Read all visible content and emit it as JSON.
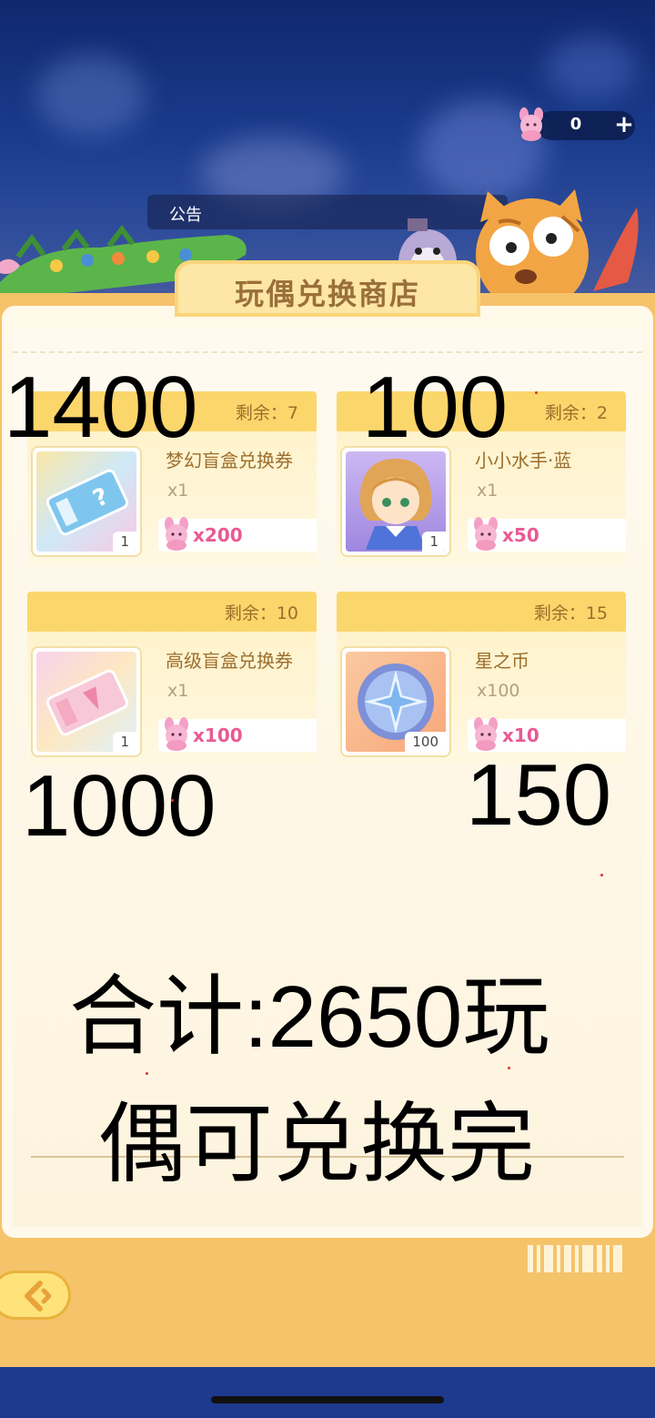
{
  "header": {
    "currency_count": "0",
    "currency_plus": "+",
    "notice_label": "公告"
  },
  "shop": {
    "title": "玩偶兑换商店",
    "remain_prefix": "剩余：",
    "items": [
      {
        "remain": "剩余：7",
        "name": "梦幻盲盒兑换券",
        "qty": "x1",
        "thumb_qty": "1",
        "price": "x200",
        "icon": "rainbow-ticket-icon"
      },
      {
        "remain": "剩余：2",
        "name": "小小水手·蓝",
        "qty": "x1",
        "thumb_qty": "1",
        "price": "x50",
        "icon": "sailor-doll-icon"
      },
      {
        "remain": "剩余：10",
        "name": "高级盲盒兑换券",
        "qty": "x1",
        "thumb_qty": "1",
        "price": "x100",
        "icon": "pink-ticket-icon"
      },
      {
        "remain": "剩余：15",
        "name": "星之币",
        "qty": "x100",
        "thumb_qty": "100",
        "price": "x10",
        "icon": "star-coin-icon"
      }
    ],
    "price_icon": "pink-bunny-doll-icon"
  },
  "annotations": {
    "card1_total": "1400",
    "card2_total": "100",
    "card3_total": "1000",
    "card4_total": "150",
    "summary_line1": "合计:2650玩",
    "summary_line2": "偶可兑换完"
  },
  "footer": {
    "back_icon": "back-arrow-icon"
  },
  "colors": {
    "accent_gold": "#fbd66b",
    "price_pink": "#e95a93",
    "text_brown": "#9c6e2d",
    "sky_blue": "#1a3b8c"
  }
}
